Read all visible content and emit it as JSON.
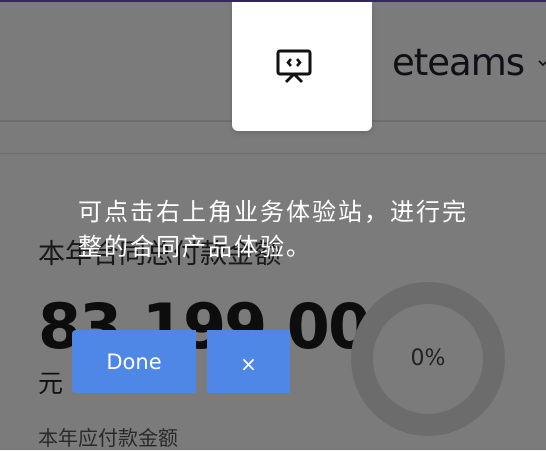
{
  "header": {
    "brand": "eteams"
  },
  "card": {
    "title": "本年合同总付款金额",
    "amount": "83,199.00",
    "currency": "元",
    "sub_label": "本年应付款金额",
    "progress_percent": 0,
    "progress_label": "0%"
  },
  "guide": {
    "text": "可点击右上角业务体验站，进行完整的合同产品体验。",
    "done_label": "Done",
    "close_label": "×"
  },
  "colors": {
    "accent_top": "#6a4bc4",
    "button": "#4f87e6",
    "overlay": "rgba(0,0,0,0.5)"
  },
  "icons": {
    "spotlight": "presentation-board-icon",
    "brand_chevron": "chevron-down-icon"
  }
}
